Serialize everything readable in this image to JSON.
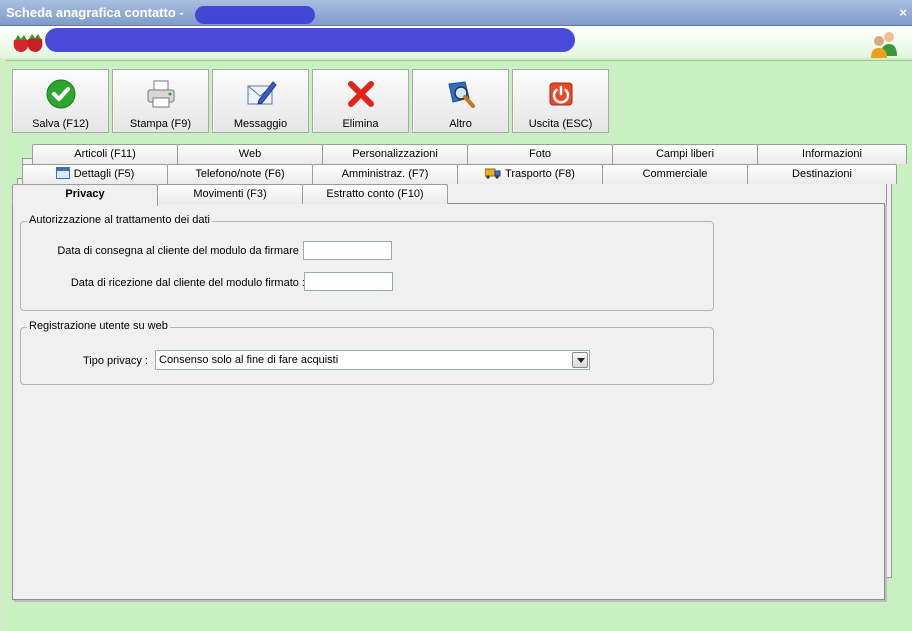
{
  "window": {
    "title": "Scheda anagrafica contatto - ",
    "close_glyph": "×"
  },
  "toolbar": {
    "buttons": [
      {
        "label": "Salva (F12)",
        "icon": "checkmark-icon"
      },
      {
        "label": "Stampa (F9)",
        "icon": "printer-icon"
      },
      {
        "label": "Messaggio",
        "icon": "message-icon"
      },
      {
        "label": "Elimina",
        "icon": "delete-icon"
      },
      {
        "label": "Altro",
        "icon": "search-book-icon"
      },
      {
        "label": "Uscita (ESC)",
        "icon": "exit-icon"
      }
    ]
  },
  "tabs": {
    "row1": [
      "Articoli (F11)",
      "Web",
      "Personalizzazioni",
      "Foto",
      "Campi liberi",
      "Informazioni"
    ],
    "row2": [
      "Dettagli (F5)",
      "Telefono/note (F6)",
      "Amministraz. (F7)",
      "Trasporto (F8)",
      "Commerciale",
      "Destinazioni"
    ],
    "row3": [
      "Privacy",
      "Movimenti (F3)",
      "Estratto conto (F10)"
    ],
    "active": "Privacy"
  },
  "privacy": {
    "group1": {
      "legend": "Autorizzazione al trattamento dei dati",
      "consegna_label": "Data di consegna al cliente del modulo da firmare :",
      "consegna_value": "",
      "ricezione_label": "Data di ricezione dal cliente del modulo firmato :",
      "ricezione_value": ""
    },
    "group2": {
      "legend": "Registrazione utente su web",
      "tipo_label": "Tipo privacy :",
      "tipo_value": "Consenso solo al fine di fare acquisti"
    }
  },
  "colors": {
    "window_bg": "#cfeec6",
    "titlebar": "#8fa9d4",
    "scribble": "#3b3bd6"
  }
}
